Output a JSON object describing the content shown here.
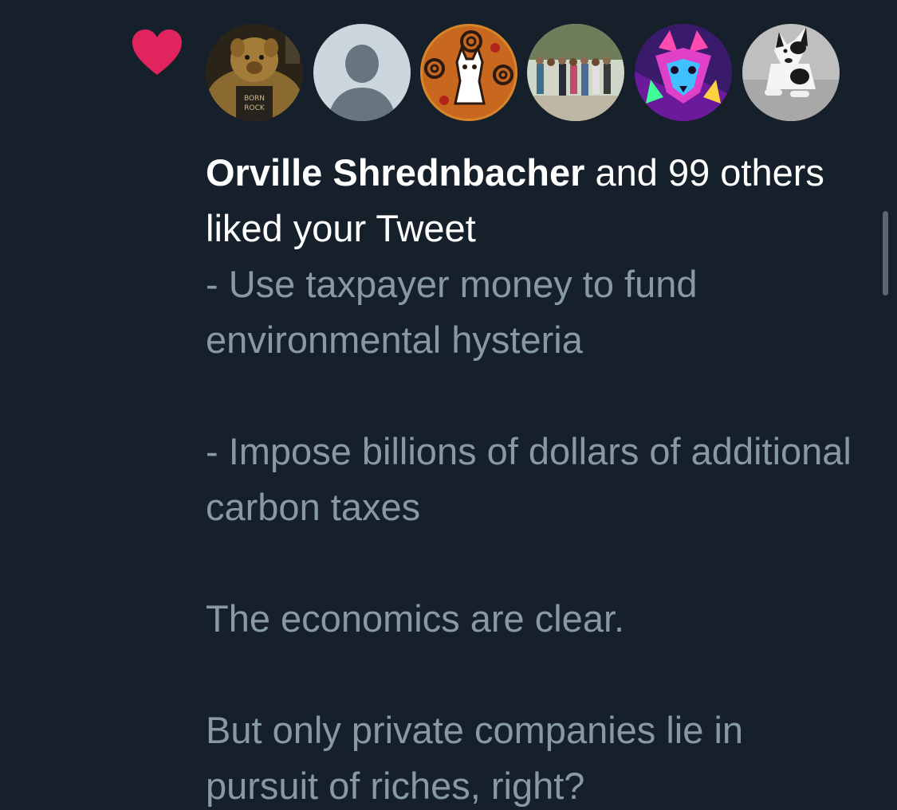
{
  "notification": {
    "type_icon": "heart-icon",
    "accent_color": "#e0245e",
    "avatars": [
      {
        "name": "avatar-plush-doll"
      },
      {
        "name": "avatar-default-placeholder"
      },
      {
        "name": "avatar-celtic-cat"
      },
      {
        "name": "avatar-group-photo"
      },
      {
        "name": "avatar-neon-fox"
      },
      {
        "name": "avatar-dog"
      }
    ],
    "liker_name": "Orville Shrednbacher",
    "headline_rest": " and 99 others liked your Tweet",
    "tweet_lines": [
      "- Use taxpayer money to fund environmental hysteria",
      "- Impose billions of dollars of additional carbon taxes",
      "The economics are clear.",
      "But only private companies lie in pursuit of riches, right?"
    ]
  },
  "theme": {
    "background": "#15202b",
    "headline_color": "#ffffff",
    "body_color": "#8899a6"
  }
}
